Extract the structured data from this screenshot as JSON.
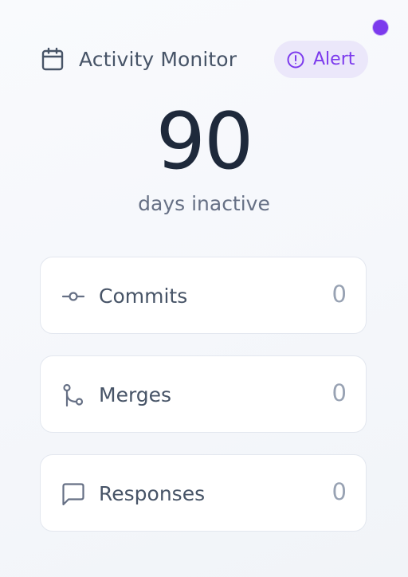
{
  "header": {
    "title": "Activity Monitor",
    "title_icon": "calendar-icon",
    "badge_label": "Alert",
    "badge_icon": "alert-circle-icon",
    "status_indicator": "online-status-dot"
  },
  "summary": {
    "value": "90",
    "label": "days inactive"
  },
  "stats": [
    {
      "label": "Commits",
      "value": "0",
      "icon": "git-commit-icon"
    },
    {
      "label": "Merges",
      "value": "0",
      "icon": "git-merge-icon"
    },
    {
      "label": "Responses",
      "value": "0",
      "icon": "message-square-icon"
    }
  ],
  "colors": {
    "accent": "#7c3aed",
    "badge_background": "#ebe7fa",
    "text_primary": "#1e293b",
    "text_secondary": "#475467",
    "text_muted": "#98a2b3",
    "card_border": "#e3e7ef"
  }
}
